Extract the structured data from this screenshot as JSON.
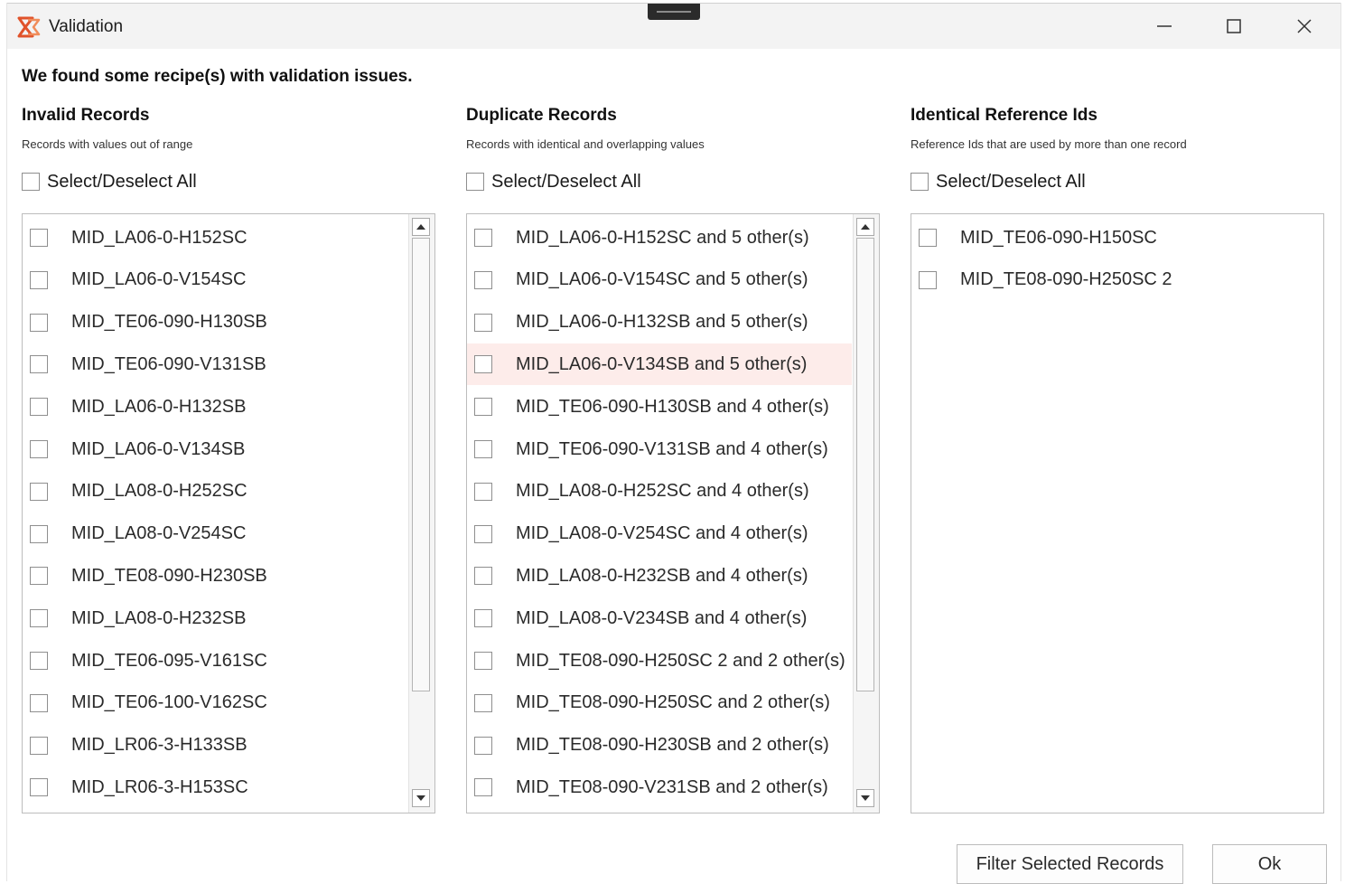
{
  "window": {
    "title": "Validation",
    "controls": {
      "minimize": "minimize-icon",
      "maximize": "maximize-icon",
      "close": "close-icon"
    }
  },
  "heading": "We found some recipe(s) with validation issues.",
  "columns": {
    "invalid": {
      "title": "Invalid Records",
      "subtitle": "Records with values out of range",
      "select_all": "Select/Deselect All",
      "items": [
        "MID_LA06-0-H152SC",
        "MID_LA06-0-V154SC",
        "MID_TE06-090-H130SB",
        "MID_TE06-090-V131SB",
        "MID_LA06-0-H132SB",
        "MID_LA06-0-V134SB",
        "MID_LA08-0-H252SC",
        "MID_LA08-0-V254SC",
        "MID_TE08-090-H230SB",
        "MID_LA08-0-H232SB",
        "MID_TE06-095-V161SC",
        "MID_TE06-100-V162SC",
        "MID_LR06-3-H133SB",
        "MID_LR06-3-H153SC"
      ]
    },
    "duplicate": {
      "title": "Duplicate Records",
      "subtitle": "Records with identical and overlapping values",
      "select_all": "Select/Deselect All",
      "items": [
        "MID_LA06-0-H152SC and 5 other(s)",
        "MID_LA06-0-V154SC and 5 other(s)",
        "MID_LA06-0-H132SB and 5 other(s)",
        "MID_LA06-0-V134SB and 5 other(s)",
        "MID_TE06-090-H130SB and 4 other(s)",
        "MID_TE06-090-V131SB and 4 other(s)",
        "MID_LA08-0-H252SC and 4 other(s)",
        "MID_LA08-0-V254SC and 4 other(s)",
        "MID_LA08-0-H232SB and 4 other(s)",
        "MID_LA08-0-V234SB and 4 other(s)",
        "MID_TE08-090-H250SC 2 and 2 other(s)",
        "MID_TE08-090-H250SC and 2 other(s)",
        "MID_TE08-090-H230SB and 2 other(s)",
        "MID_TE08-090-V231SB and 2 other(s)"
      ],
      "highlighted_index": 3
    },
    "identical": {
      "title": "Identical Reference Ids",
      "subtitle": "Reference Ids that are used by more than one record",
      "select_all": "Select/Deselect All",
      "items": [
        "MID_TE06-090-H150SC",
        "MID_TE08-090-H250SC 2"
      ]
    }
  },
  "buttons": {
    "filter": "Filter Selected Records",
    "ok": "Ok"
  },
  "colors": {
    "highlight_row": "#fdecea",
    "accent": "#e0522a"
  }
}
